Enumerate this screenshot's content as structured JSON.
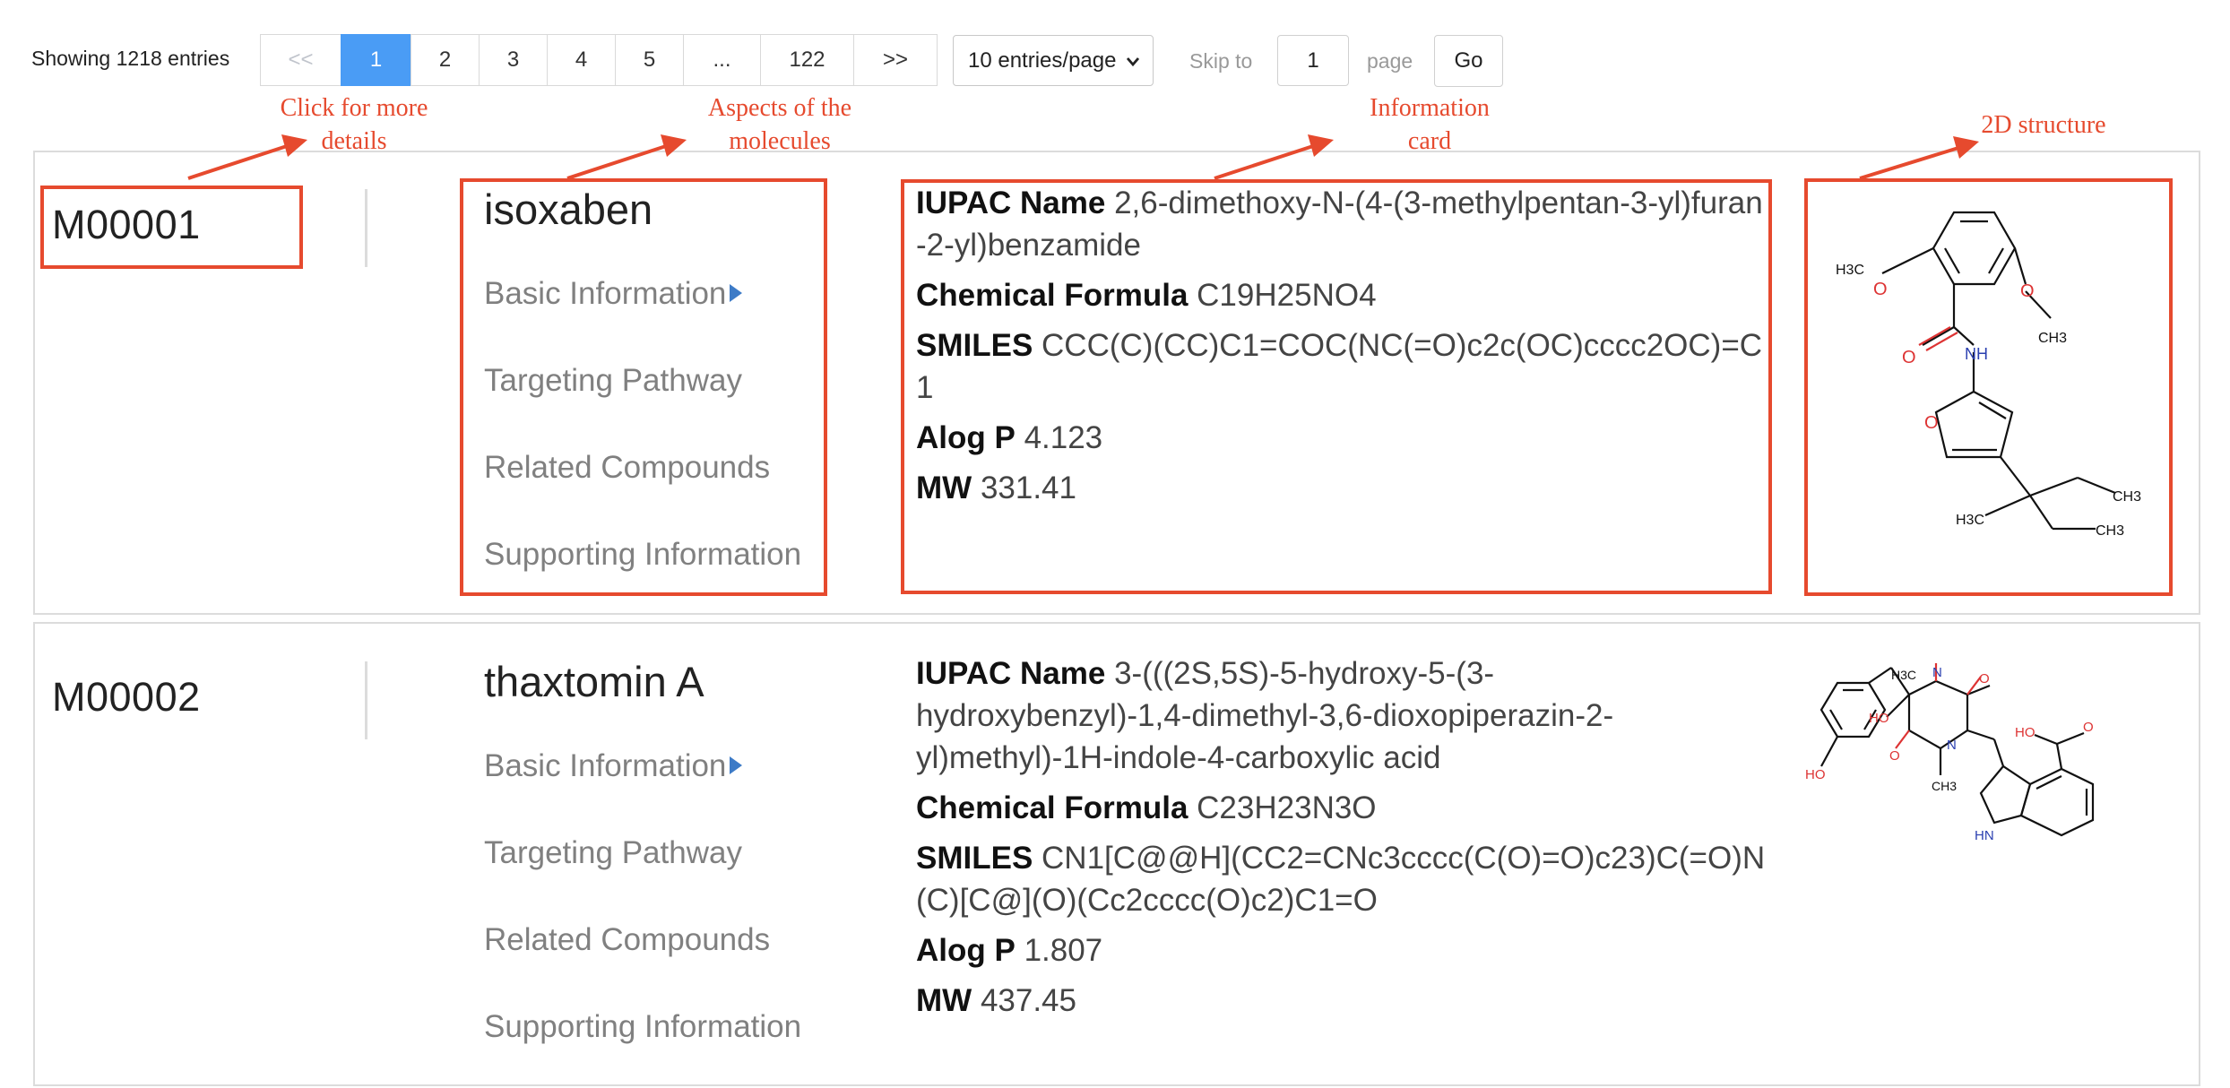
{
  "pagination": {
    "showing": "Showing 1218 entries",
    "prev": "<<",
    "pages": [
      "1",
      "2",
      "3",
      "4",
      "5",
      "...",
      "122"
    ],
    "next": ">>",
    "active_page": "1",
    "per_page": "10 entries/page",
    "skip_label": "Skip to",
    "skip_value": "1",
    "page_label": "page",
    "go": "Go"
  },
  "annotations": {
    "details": "Click for more details",
    "aspects": "Aspects of the molecules",
    "info_card": "Information card",
    "structure": "2D structure",
    "color": "#e64a2e"
  },
  "molecules": [
    {
      "id": "M00001",
      "name": "isoxaben",
      "nav": [
        "Basic Information",
        "Targeting Pathway",
        "Related Compounds",
        "Supporting Information"
      ],
      "iupac_label": "IUPAC Name",
      "iupac": "2,6-dimethoxy-N-(4-(3-methylpentan-3-yl)furan-2-yl)benzamide",
      "formula_label": "Chemical Formula",
      "formula": "C19H25NO4",
      "smiles_label": "SMILES",
      "smiles": "CCC(C)(CC)C1=COC(NC(=O)c2c(OC)cccc2OC)=C1",
      "alogp_label": "Alog P",
      "alogp": "4.123",
      "mw_label": "MW",
      "mw": "331.41",
      "atoms": {
        "h3c": "H3C",
        "ch3": "CH3",
        "nh": "NH",
        "o": "O",
        "h3c_b": "H3C"
      }
    },
    {
      "id": "M00002",
      "name": "thaxtomin A",
      "nav": [
        "Basic Information",
        "Targeting Pathway",
        "Related Compounds",
        "Supporting Information"
      ],
      "iupac_label": "IUPAC Name",
      "iupac": "3-(((2S,5S)-5-hydroxy-5-(3-hydroxybenzyl)-1,4-dimethyl-3,6-dioxopiperazin-2-yl)methyl)-1H-indole-4-carboxylic acid",
      "formula_label": "Chemical Formula",
      "formula": "C23H23N3O",
      "smiles_label": "SMILES",
      "smiles": "CN1[C@@H](CC2=CNc3cccc(C(O)=O)c23)C(=O)N(C)[C@](O)(Cc2cccc(O)c2)C1=O",
      "alogp_label": "Alog P",
      "alogp": "1.807",
      "mw_label": "MW",
      "mw": "437.45",
      "atoms": {
        "ho": "HO",
        "oh": "OH",
        "n": "N",
        "hn": "HN",
        "o": "O",
        "h3c": "H3C",
        "ch3": "CH3"
      }
    }
  ]
}
